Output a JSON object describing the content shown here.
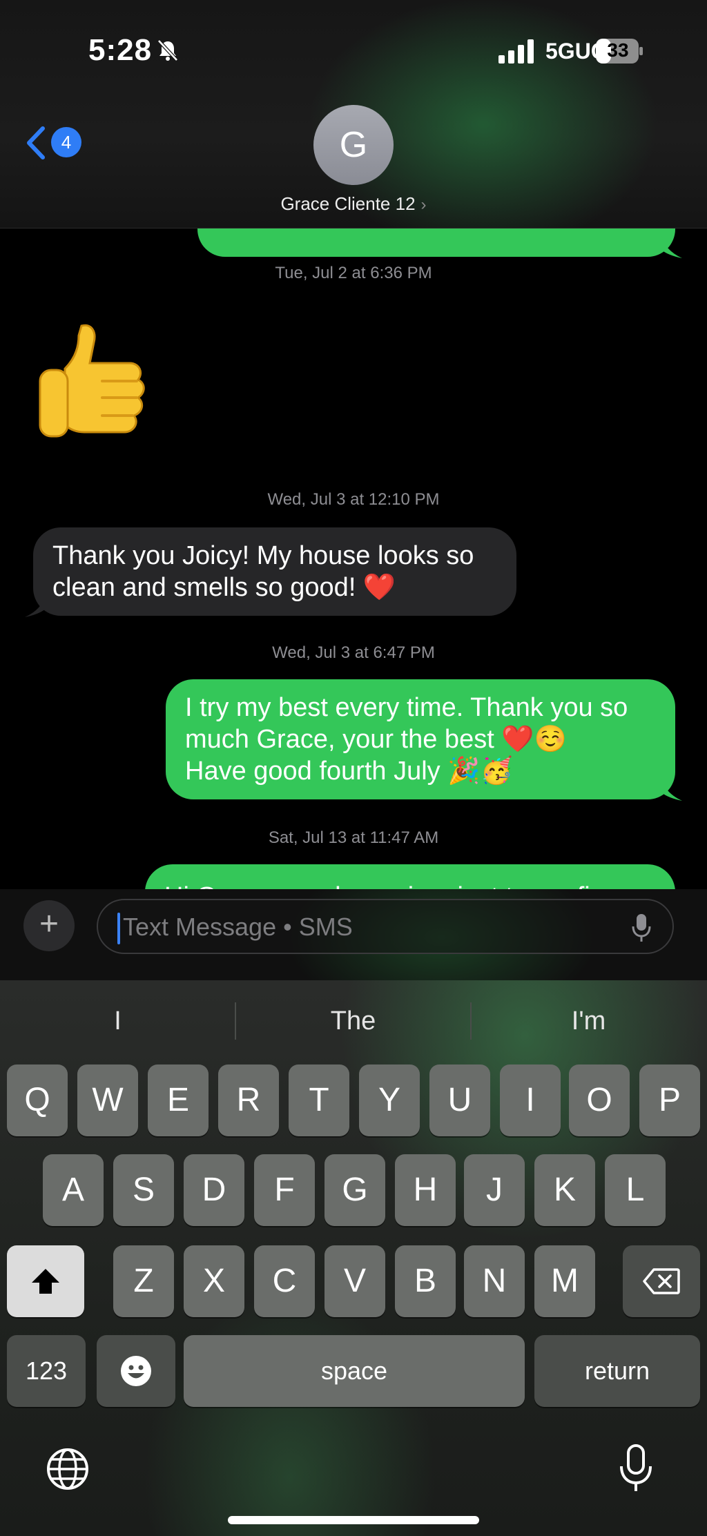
{
  "status_bar": {
    "time": "5:28",
    "network": "5GUC",
    "battery": "33",
    "icons": [
      "bell-slash-icon",
      "cellular-signal-icon",
      "battery-icon"
    ]
  },
  "header": {
    "back_badge": "4",
    "avatar_initial": "G",
    "contact_name": "Grace Cliente 12",
    "contact_chevron": "›"
  },
  "thread": {
    "timestamps": [
      "Tue, Jul 2 at 6:36 PM",
      "Wed, Jul 3 at 12:10 PM",
      "Wed, Jul 3 at 6:47 PM",
      "Sat, Jul 13 at 11:47 AM"
    ],
    "messages": [
      {
        "direction": "incoming",
        "type": "emoji",
        "text": "👍"
      },
      {
        "direction": "incoming",
        "type": "text",
        "lines": [
          "Thank you Joicy! My house looks so",
          "clean and smells so good! ❤️"
        ]
      },
      {
        "direction": "outgoing",
        "type": "text",
        "lines": [
          "I try my best every time. Thank you so",
          "much Grace, your the best ❤️☺️",
          "Have good fourth July 🎉🥳"
        ]
      },
      {
        "direction": "outgoing",
        "type": "text",
        "lines": [
          "Hi Grace, good morning, just to confirm"
        ]
      }
    ],
    "colors": {
      "outgoing": "#34c759",
      "incoming": "#262628",
      "timestamp": "#8e8e93"
    }
  },
  "input": {
    "plus_label": "+",
    "placeholder": "Text Message • SMS"
  },
  "keyboard": {
    "suggestions": [
      "I",
      "The",
      "I'm"
    ],
    "row1": [
      "Q",
      "W",
      "E",
      "R",
      "T",
      "Y",
      "U",
      "I",
      "O",
      "P"
    ],
    "row2": [
      "A",
      "S",
      "D",
      "F",
      "G",
      "H",
      "J",
      "K",
      "L"
    ],
    "row3": [
      "Z",
      "X",
      "C",
      "V",
      "B",
      "N",
      "M"
    ],
    "numbers_label": "123",
    "space_label": "space",
    "return_label": "return"
  }
}
